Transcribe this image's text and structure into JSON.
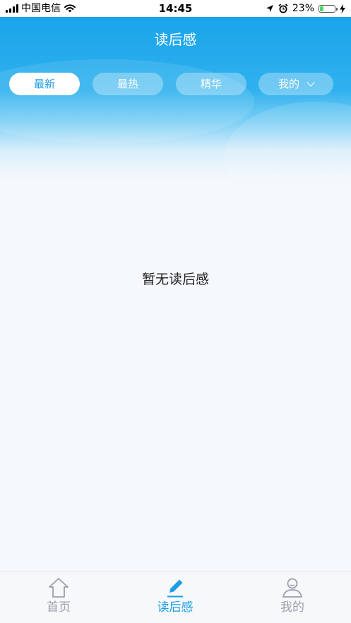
{
  "status_bar": {
    "carrier": "中国电信",
    "time": "14:45",
    "battery_percent": "23%",
    "battery_level": 0.23
  },
  "header": {
    "title": "读后感",
    "tabs": [
      {
        "label": "最新",
        "active": true
      },
      {
        "label": "最热",
        "active": false
      },
      {
        "label": "精华",
        "active": false
      },
      {
        "label": "我的",
        "active": false,
        "dropdown": true
      }
    ]
  },
  "main": {
    "empty_text": "暂无读后感"
  },
  "bottom_nav": {
    "items": [
      {
        "label": "首页",
        "icon": "home-icon",
        "active": false
      },
      {
        "label": "读后感",
        "icon": "pencil-icon",
        "active": true
      },
      {
        "label": "我的",
        "icon": "person-icon",
        "active": false
      }
    ]
  },
  "colors": {
    "accent": "#1a9ee6",
    "header_top": "#1aa4ea",
    "inactive_nav": "#9aa0ab",
    "background": "#f5f8fc"
  }
}
